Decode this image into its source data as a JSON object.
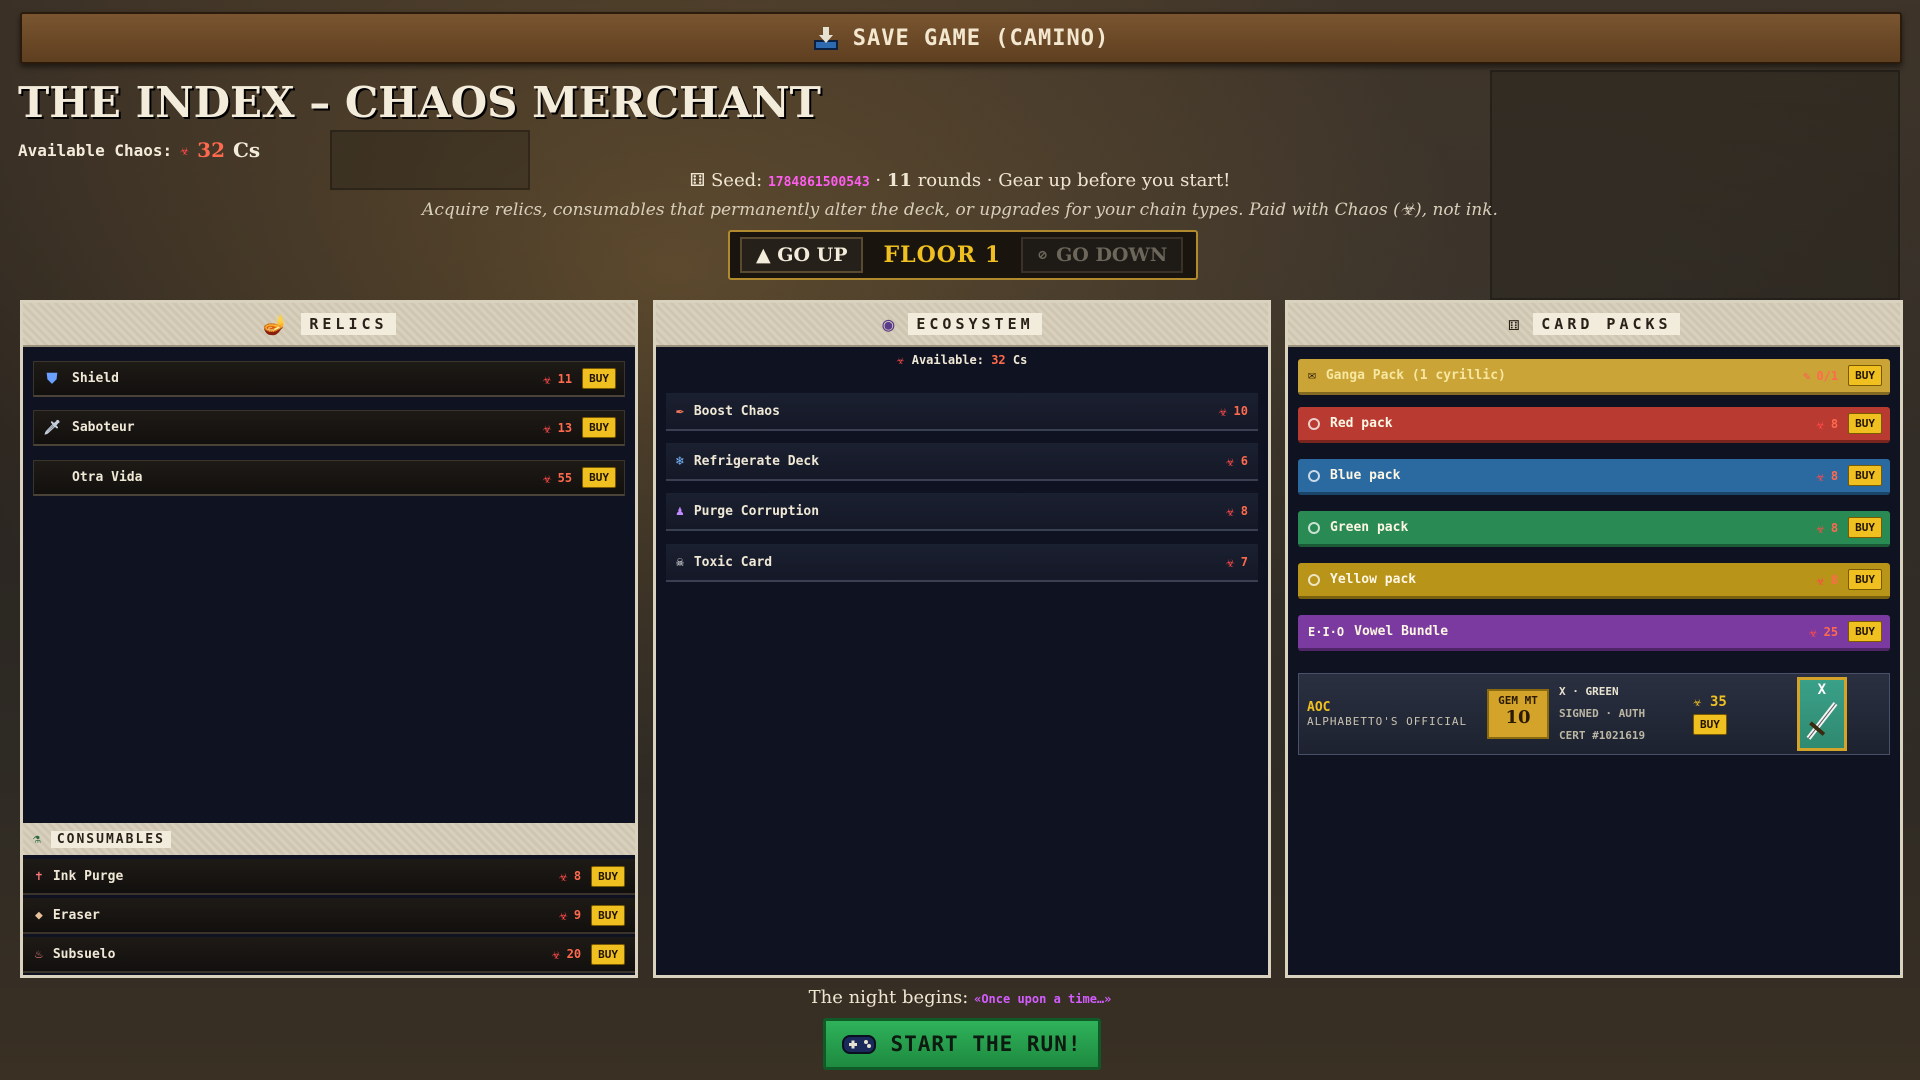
{
  "header": {
    "save_label": "SAVE GAME (CAMINO)",
    "title": "THE INDEX – CHAOS MERCHANT",
    "available_label": "Available Chaos:",
    "available_value": "32",
    "available_unit": "Cs"
  },
  "seed": {
    "prefix": "Seed:",
    "value": "1784861500543",
    "sep1": "·",
    "rounds": "11",
    "rounds_text": "rounds · Gear up before you start!",
    "description": "Acquire relics, consumables that permanently alter the deck, or upgrades for your chain types. Paid with Chaos (☣), not ink."
  },
  "floor_nav": {
    "up_label": "▲ GO UP",
    "floor_label": "FLOOR 1",
    "down_label": "GO DOWN"
  },
  "relics": {
    "title": "RELICS",
    "items": [
      {
        "name": "Shield",
        "price": "11",
        "icon": "shield-icon"
      },
      {
        "name": "Saboteur",
        "price": "13",
        "icon": "dagger-icon"
      },
      {
        "name": "Otra Vida",
        "price": "55",
        "icon": ""
      }
    ],
    "buy": "BUY"
  },
  "consumables": {
    "title": "CONSUMABLES",
    "items": [
      {
        "name": "Ink Purge",
        "price": "8",
        "icon": "ink-icon"
      },
      {
        "name": "Eraser",
        "price": "9",
        "icon": "eraser-icon"
      },
      {
        "name": "Subsuelo",
        "price": "20",
        "icon": "bottle-icon"
      }
    ]
  },
  "ecosystem": {
    "title": "ECOSYSTEM",
    "available_label": "Available:",
    "available_value": "32",
    "available_unit": "Cs",
    "items": [
      {
        "name": "Boost Chaos",
        "price": "10",
        "icon": "feather-icon"
      },
      {
        "name": "Refrigerate Deck",
        "price": "6",
        "icon": "snowflake-icon"
      },
      {
        "name": "Purge Corruption",
        "price": "8",
        "icon": "figure-icon"
      },
      {
        "name": "Toxic Card",
        "price": "7",
        "icon": "skull-icon"
      }
    ]
  },
  "card_packs": {
    "title": "CARD PACKS",
    "items": [
      {
        "name": "Ganga Pack (1 cyrillic)",
        "price": "0/1",
        "color": "#caa436"
      },
      {
        "name": "Red pack",
        "price": "8",
        "color": "#b83a30"
      },
      {
        "name": "Blue pack",
        "price": "8",
        "color": "#2a6aa0"
      },
      {
        "name": "Green pack",
        "price": "8",
        "color": "#2a8a54"
      },
      {
        "name": "Yellow pack",
        "price": "8",
        "color": "#b89418"
      },
      {
        "name": "Vowel Bundle",
        "price": "25",
        "color": "#7a3aa0",
        "prefix": "E·I·O"
      }
    ],
    "aoc": {
      "t1": "AOC",
      "t2": "ALPHABETTO'S OFFICIAL",
      "gem_label": "GEM MT",
      "gem_value": "10",
      "line1": "X · GREEN",
      "line2": "SIGNED · AUTH",
      "line3": "CERT #1021619",
      "price": "35",
      "card_letter": "X"
    }
  },
  "footer": {
    "night_text": "The night begins:",
    "night_quote": "«Once upon a time…»",
    "start_label": "START THE RUN!"
  },
  "colors": {
    "gold": "#f0c020",
    "chaos_red": "#ff6a4e",
    "magenta": "#ff5cf0"
  }
}
